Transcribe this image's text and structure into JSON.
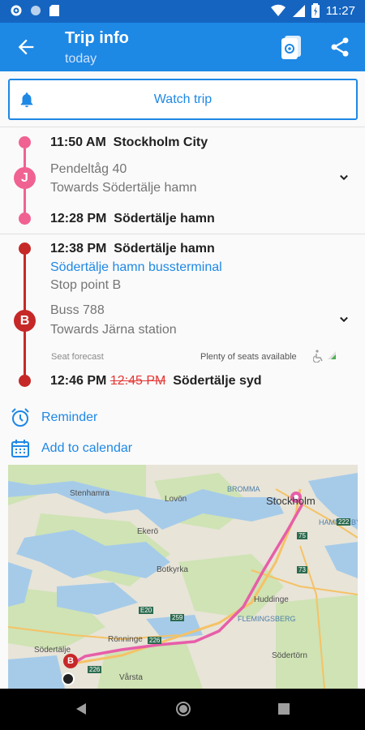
{
  "status_bar": {
    "time": "11:27"
  },
  "app_bar": {
    "title": "Trip info",
    "subtitle": "today"
  },
  "watch_button": {
    "label": "Watch trip"
  },
  "legs": [
    {
      "line_color": "#f06292",
      "badge": "J",
      "departure_time": "11:50 AM",
      "departure_stop": "Stockholm City",
      "service": "Pendeltåg 40",
      "direction": "Towards Södertälje hamn",
      "arrival_time": "12:28 PM",
      "arrival_stop": "Södertälje hamn"
    },
    {
      "line_color": "#c62828",
      "badge": "B",
      "departure_time": "12:38 PM",
      "departure_stop": "Södertälje hamn",
      "station_link": "Södertälje hamn bussterminal",
      "stop_point": "Stop point B",
      "service": "Buss 788",
      "direction": "Towards Järna station",
      "seat_forecast_label": "Seat forecast",
      "seat_forecast_value": "Plenty of seats available",
      "arrival_time": "12:46 PM",
      "arrival_scheduled": "12:45 PM",
      "arrival_stop": "Södertälje syd"
    }
  ],
  "actions": {
    "reminder": "Reminder",
    "calendar": "Add to calendar"
  },
  "map": {
    "labels": {
      "stockholm": "Stockholm",
      "stenhamra": "Stenhamra",
      "lovon": "Lovön",
      "ekero": "Ekerö",
      "botkyrka": "Botkyrka",
      "huddinge": "Huddinge",
      "flemingsberg": "FLEMINGSBERG",
      "sodertalje": "Södertälje",
      "sodertorn": "Södertörn",
      "varsta": "Vårsta",
      "bromma": "BROMMA",
      "hammarby": "HAMMARBY",
      "ronninge": "Rönninge"
    },
    "roads": {
      "r75": "75",
      "r73": "73",
      "r226a": "226",
      "r226b": "226",
      "r259": "259",
      "r222": "222",
      "e20": "E20"
    },
    "marker": "B"
  }
}
